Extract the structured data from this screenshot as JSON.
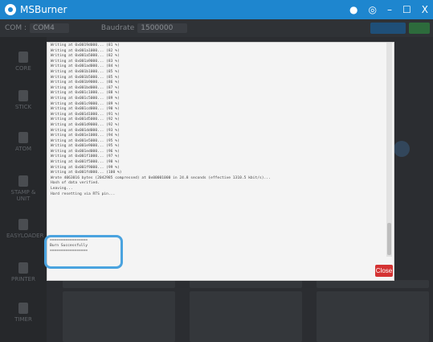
{
  "window": {
    "title": "MSBurner",
    "controls": {
      "user": "●",
      "settings": "◎",
      "minimize": "–",
      "maximize": "☐",
      "close": "X"
    }
  },
  "toolbar": {
    "com_label": "COM :",
    "com_value": "COM4",
    "baud_label": "Baudrate",
    "baud_value": "1500000"
  },
  "log": {
    "lines": [
      "Writing at 0x0019d000... (81 %)",
      "Writing at 0x001a1000... (82 %)",
      "Writing at 0x001a5000... (82 %)",
      "Writing at 0x001a9000... (83 %)",
      "Writing at 0x001ad000... (84 %)",
      "Writing at 0x001b1000... (85 %)",
      "Writing at 0x001b5000... (85 %)",
      "Writing at 0x001b9000... (86 %)",
      "Writing at 0x001bd000... (87 %)",
      "Writing at 0x001c1000... (88 %)",
      "Writing at 0x001c5000... (89 %)",
      "Writing at 0x001c9000... (89 %)",
      "Writing at 0x001cd000... (90 %)",
      "Writing at 0x001d1000... (91 %)",
      "Writing at 0x001d5000... (92 %)",
      "Writing at 0x001d9000... (92 %)",
      "Writing at 0x001dd000... (93 %)",
      "Writing at 0x001e1000... (94 %)",
      "Writing at 0x001e5000... (95 %)",
      "Writing at 0x001e9000... (95 %)",
      "Writing at 0x001ed000... (96 %)",
      "Writing at 0x001f1000... (97 %)",
      "Writing at 0x001f5000... (98 %)",
      "Writing at 0x001f9000... (99 %)",
      "Writing at 0x001fd000... (100 %)",
      "Wrote 4063016 bytes (2042985 compressed) at 0x00001000 in 24.8 seconds (effective 1310.5 kbit/s)...",
      "Hash of data verified.",
      "",
      "Leaving...",
      "Hard resetting via RTS pin..."
    ],
    "success": {
      "rule": "=================",
      "message": "Burn Successfully"
    }
  },
  "close_button": "Close",
  "sidebar": [
    "CORE",
    "STICK",
    "ATOM",
    "STAMP & UNIT",
    "EASYLOADER",
    "PRINTER",
    "TIMER"
  ],
  "colors": {
    "titlebar": "#1e86cf",
    "close": "#d43333",
    "highlight": "#4aa3df"
  }
}
